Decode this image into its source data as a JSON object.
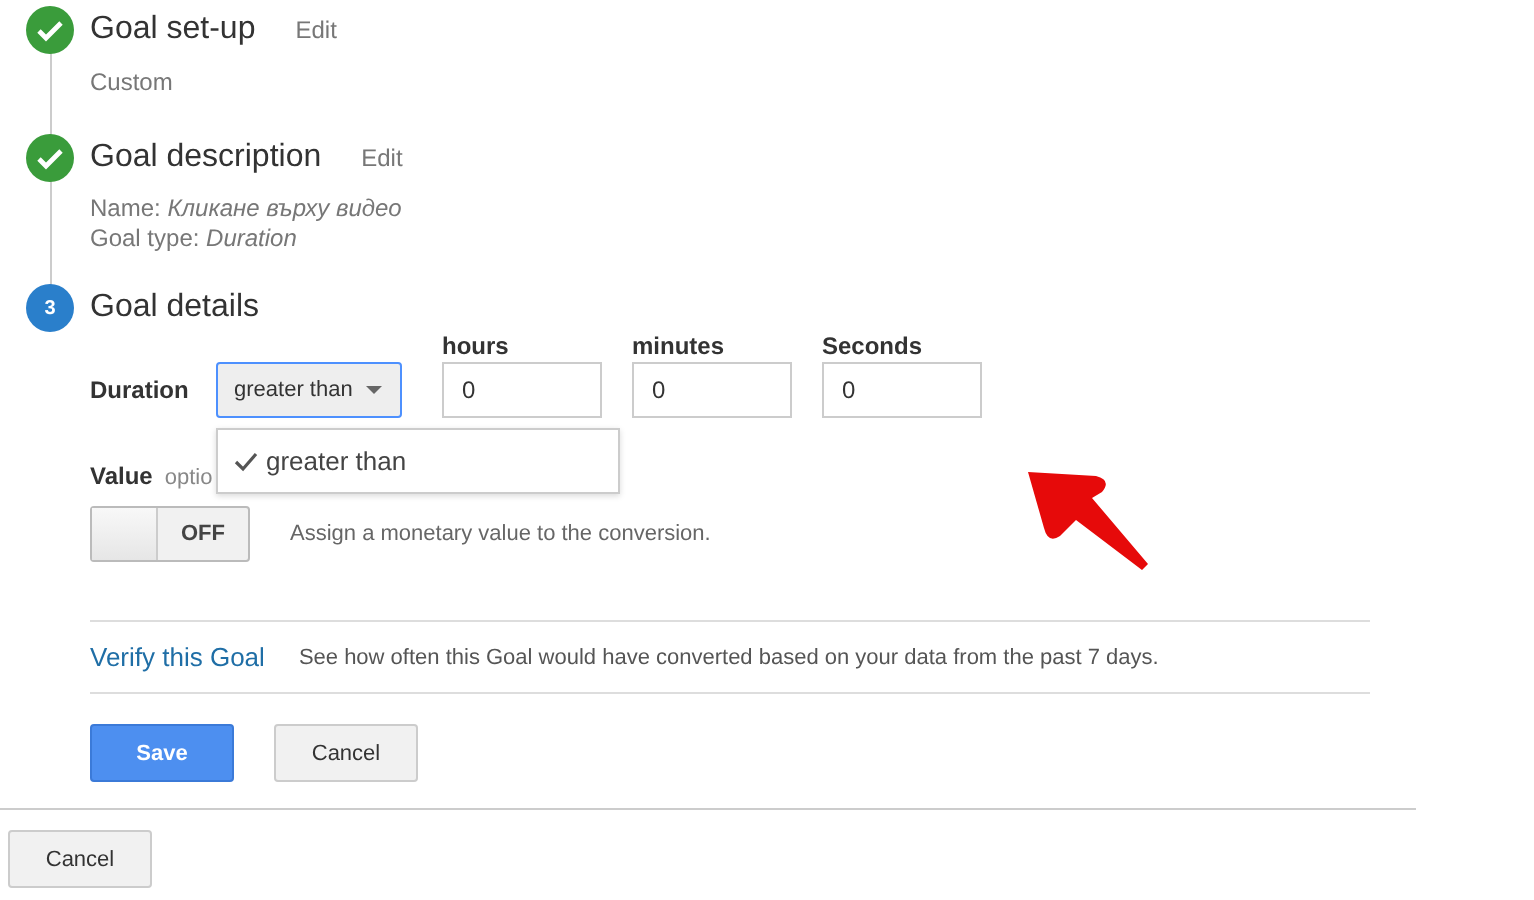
{
  "steps": [
    {
      "title": "Goal set-up",
      "kind": "done",
      "edit": "Edit",
      "details": [
        {
          "label": "Custom"
        }
      ]
    },
    {
      "title": "Goal description",
      "kind": "done",
      "edit": "Edit",
      "details": [
        {
          "label": "Name: ",
          "value": "Кликане върху видео"
        },
        {
          "label": "Goal type: ",
          "value": "Duration"
        }
      ]
    },
    {
      "title": "Goal details",
      "kind": "current",
      "number": "3"
    }
  ],
  "duration": {
    "label": "Duration",
    "select": "greater than",
    "fields": [
      {
        "label": "hours",
        "value": "0"
      },
      {
        "label": "minutes",
        "value": "0"
      },
      {
        "label": "Seconds",
        "value": "0"
      }
    ],
    "menu": [
      {
        "label": "greater than",
        "selected": true
      }
    ]
  },
  "value": {
    "label": "Value",
    "hint": "optio",
    "toggle": {
      "on": false,
      "label": "OFF"
    },
    "description": "Assign a monetary value to the conversion."
  },
  "verify": {
    "link": "Verify this Goal",
    "text": "See how often this Goal would have converted based on your data from the past 7 days."
  },
  "buttons": [
    {
      "label": "Save",
      "kind": "primary"
    },
    {
      "label": "Cancel",
      "kind": "secondary"
    }
  ],
  "footer_button": "Cancel"
}
